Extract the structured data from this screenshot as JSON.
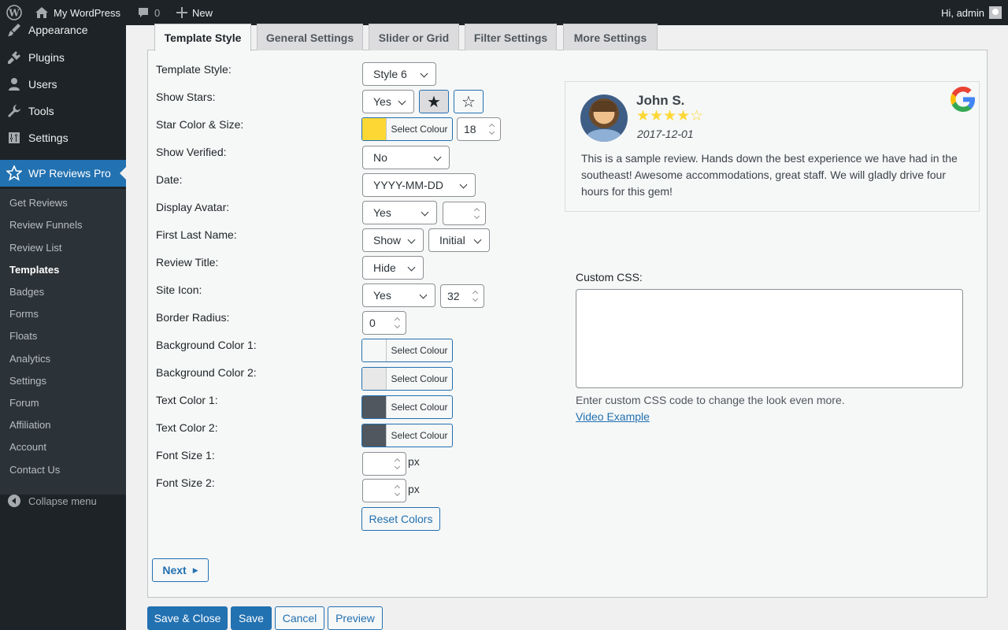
{
  "admin_bar": {
    "site_name": "My WordPress",
    "comments_count": "0",
    "new_label": "New",
    "greeting": "Hi, admin"
  },
  "sidebar": {
    "top_items": [
      {
        "label": "Appearance",
        "icon": "paintbrush-icon"
      },
      {
        "label": "Plugins",
        "icon": "plugin-icon"
      },
      {
        "label": "Users",
        "icon": "users-icon"
      },
      {
        "label": "Tools",
        "icon": "wrench-icon"
      },
      {
        "label": "Settings",
        "icon": "settings-sliders-icon"
      },
      {
        "label": "WP Reviews Pro",
        "icon": "star-icon"
      }
    ],
    "sub_items": [
      "Get Reviews",
      "Review Funnels",
      "Review List",
      "Templates",
      "Badges",
      "Forms",
      "Floats",
      "Analytics",
      "Settings",
      "Forum",
      "Affiliation",
      "Account",
      "Contact Us"
    ],
    "active_sub": "Templates",
    "collapse_label": "Collapse menu"
  },
  "tabs": [
    "Template Style",
    "General Settings",
    "Slider or Grid",
    "Filter Settings",
    "More Settings"
  ],
  "form": {
    "template_style": {
      "label": "Template Style:",
      "value": "Style 6"
    },
    "show_stars": {
      "label": "Show Stars:",
      "value": "Yes"
    },
    "star_color_size": {
      "label": "Star Color & Size:",
      "color": "#fdd835",
      "button": "Select Colour",
      "size": "18"
    },
    "show_verified": {
      "label": "Show Verified:",
      "value": "No"
    },
    "date": {
      "label": "Date:",
      "value": "YYYY-MM-DD"
    },
    "display_avatar": {
      "label": "Display Avatar:",
      "value": "Yes",
      "size": ""
    },
    "first_last_name": {
      "label": "First Last Name:",
      "first": "Show",
      "last": "Initial"
    },
    "review_title": {
      "label": "Review Title:",
      "value": "Hide"
    },
    "site_icon": {
      "label": "Site Icon:",
      "value": "Yes",
      "size": "32"
    },
    "border_radius": {
      "label": "Border Radius:",
      "value": "0"
    },
    "bg_color_1": {
      "label": "Background Color 1:",
      "color": "#f6f7f7",
      "button": "Select Colour"
    },
    "bg_color_2": {
      "label": "Background Color 2:",
      "color": "#e8e8e8",
      "button": "Select Colour"
    },
    "text_color_1": {
      "label": "Text Color 1:",
      "color": "#50575e",
      "button": "Select Colour"
    },
    "text_color_2": {
      "label": "Text Color 2:",
      "color": "#50575e",
      "button": "Select Colour"
    },
    "font_size_1": {
      "label": "Font Size 1:",
      "value": "",
      "unit": "px"
    },
    "font_size_2": {
      "label": "Font Size 2:",
      "value": "",
      "unit": "px"
    },
    "reset_colors": "Reset Colors"
  },
  "preview": {
    "name": "John S.",
    "rating": 4,
    "stars_text": "★★★★☆",
    "date": "2017-12-01",
    "text": "This is a sample review. Hands down the best experience we have had in the southeast! Awesome accommodations, great staff. We will gladly drive four hours for this gem!"
  },
  "custom_css": {
    "label": "Custom CSS:",
    "value": "",
    "help": "Enter custom CSS code to change the look even more.",
    "link": "Video Example"
  },
  "buttons": {
    "next": "Next",
    "save_close": "Save & Close",
    "save": "Save",
    "cancel": "Cancel",
    "preview": "Preview"
  },
  "colors": {
    "accent": "#2271b1",
    "adminbar": "#1d2327",
    "star": "#fdd835"
  }
}
